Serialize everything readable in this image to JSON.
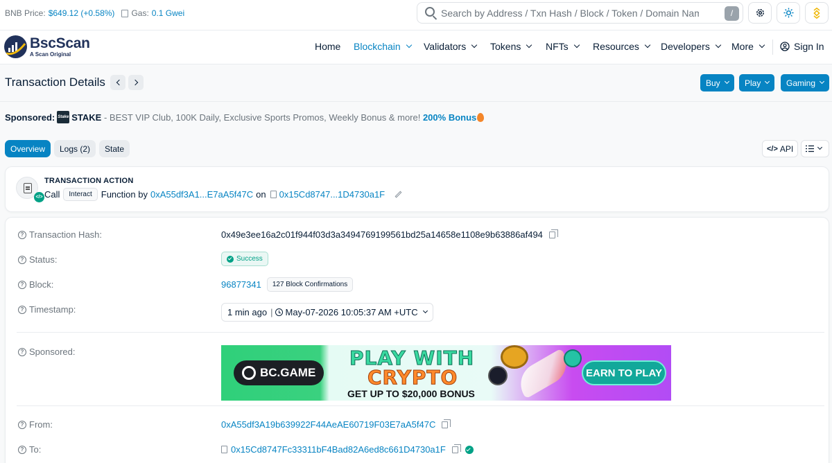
{
  "topbar": {
    "price_label": "BNB Price:",
    "price_value": "$649.12 (+0.58%)",
    "gas_label": "Gas:",
    "gas_value": "0.1 Gwei",
    "search_placeholder": "Search by Address / Txn Hash / Block / Token / Domain Name",
    "search_shortcut": "/"
  },
  "logo": {
    "name": "BscScan",
    "tagline": "A Scan Original"
  },
  "nav": {
    "items": [
      {
        "label": "Home",
        "dropdown": false
      },
      {
        "label": "Blockchain",
        "dropdown": true,
        "active": true
      },
      {
        "label": "Validators",
        "dropdown": true
      },
      {
        "label": "Tokens",
        "dropdown": true
      },
      {
        "label": "NFTs",
        "dropdown": true
      },
      {
        "label": "Resources",
        "dropdown": true
      },
      {
        "label": "Developers",
        "dropdown": true
      },
      {
        "label": "More",
        "dropdown": true
      }
    ],
    "signin": "Sign In"
  },
  "page": {
    "title": "Transaction Details",
    "buttons": [
      "Buy",
      "Play",
      "Gaming"
    ]
  },
  "sponsored_line": {
    "label": "Sponsored:",
    "logo_text": "Stake",
    "brand": "STAKE",
    "text": " - BEST VIP Club, 100K Daily, Exclusive Sports Promos, Weekly Bonus & more! ",
    "link": "200% Bonus"
  },
  "tabs": {
    "items": [
      "Overview",
      "Logs (2)",
      "State"
    ],
    "api": "API"
  },
  "tx_action": {
    "title": "TRANSACTION ACTION",
    "call": "Call",
    "pill": "Interact",
    "function_by": "Function by",
    "from_short": "0xA55df3A1...E7aA5f47C",
    "on": "on",
    "to_short": "0x15Cd8747...1D4730a1F"
  },
  "details": {
    "hash_label": "Transaction Hash:",
    "hash_value": "0x49e3ee16a2c01f944f03d3a3494769199561bd25a14658e1108e9b63886af494",
    "status_label": "Status:",
    "status_value": "Success",
    "block_label": "Block:",
    "block_value": "96877341",
    "block_conf": "127 Block Confirmations",
    "ts_label": "Timestamp:",
    "ts_ago": "1 min ago",
    "ts_sep": "|",
    "ts_value": "May-07-2026 10:05:37 AM +UTC",
    "sponsored_label": "Sponsored:",
    "from_label": "From:",
    "from_value": "0xA55df3A19b639922F44AeAE60719F03E7aA5f47C",
    "to_label": "To:",
    "to_value": "0x15Cd8747Fc33311bF4Bad82A6ed8c661D4730a1F"
  },
  "banner": {
    "logo": "BC.GAME",
    "line1": "PLAY WITH",
    "line2": "CRYPTO",
    "line3": "GET UP TO $20,000 BONUS",
    "cta": "EARN TO PLAY"
  },
  "colors": {
    "link": "#0784c3",
    "success": "#00a186",
    "text": "#081d35",
    "muted": "#6c757d"
  }
}
